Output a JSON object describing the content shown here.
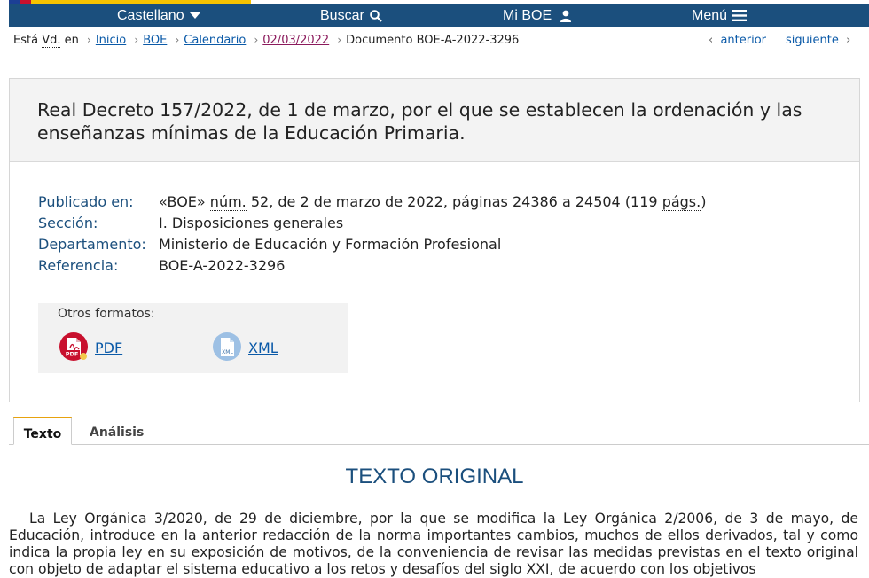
{
  "nav": {
    "language": "Castellano",
    "search": "Buscar",
    "my_boe": "Mi BOE",
    "menu": "Menú"
  },
  "breadcrumb": {
    "prefix_a": "Está",
    "prefix_abbr": "Vd.",
    "prefix_b": "en",
    "items": [
      "Inicio",
      "BOE",
      "Calendario",
      "02/03/2022"
    ],
    "current": "Documento BOE-A-2022-3296"
  },
  "pager": {
    "previous": "anterior",
    "next": "siguiente"
  },
  "document": {
    "title": "Real Decreto 157/2022, de 1 de marzo, por el que se establecen la ordenación y las enseñanzas mínimas de la Educación Primaria.",
    "meta": {
      "published_label": "Publicado en:",
      "published_boe": "«BOE»",
      "published_num_abbr": "núm.",
      "published_rest": " 52, de 2 de marzo de 2022, páginas 24386 a 24504 (119 ",
      "published_pags_abbr": "págs.",
      "published_close": ")",
      "section_label": "Sección:",
      "section_value": "I. Disposiciones generales",
      "department_label": "Departamento:",
      "department_value": "Ministerio de Educación y Formación Profesional",
      "reference_label": "Referencia:",
      "reference_value": "BOE-A-2022-3296"
    },
    "formats": {
      "title": "Otros formatos:",
      "pdf": "PDF",
      "xml": "XML",
      "pdf_badge": "PDF",
      "xml_badge": "XML"
    }
  },
  "tabs": [
    {
      "label": "Texto",
      "active": true
    },
    {
      "label": "Análisis",
      "active": false
    }
  ],
  "text": {
    "heading": "TEXTO ORIGINAL",
    "paragraph": "La Ley Orgánica 3/2020, de 29 de diciembre, por la que se modifica la Ley Orgánica 2/2006, de 3 de mayo, de Educación, introduce en la anterior redacción de la norma importantes cambios, muchos de ellos derivados, tal y como indica la propia ley en su exposición de motivos, de la conveniencia de revisar las medidas previstas en el texto original con objeto de adaptar el sistema educativo a los retos y desafíos del siglo XXI, de acuerdo con los objetivos"
  },
  "colors": {
    "nav_bg": "#1b4f7d",
    "link": "#0b5aa8",
    "visited_link": "#8b1a5c",
    "tab_accent": "#e7a20e",
    "pdf_icon": "#c8102e",
    "xml_icon": "#7aa8d6"
  }
}
